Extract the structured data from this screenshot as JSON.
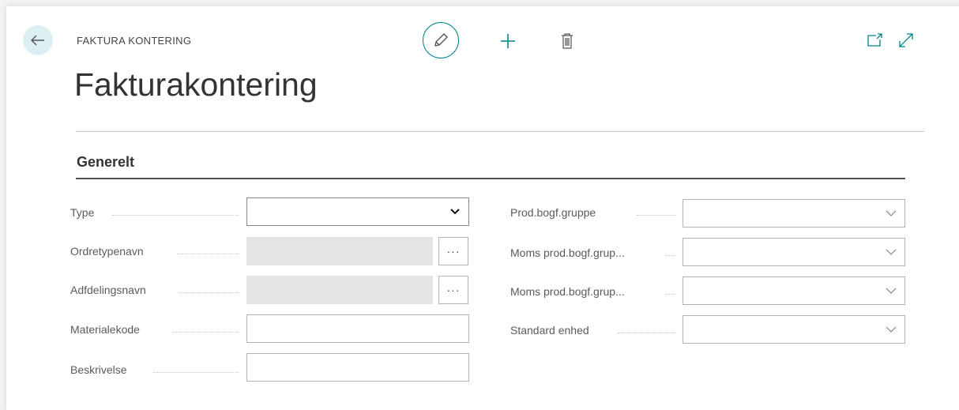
{
  "header": {
    "caption": "FAKTURA KONTERING",
    "title": "Fakturakontering"
  },
  "section": {
    "title": "Generelt"
  },
  "left_fields": [
    {
      "label": "Type",
      "value": ""
    },
    {
      "label": "Ordretypenavn",
      "value": ""
    },
    {
      "label": "Adfdelingsnavn",
      "value": ""
    },
    {
      "label": "Materialekode",
      "value": ""
    },
    {
      "label": "Beskrivelse",
      "value": ""
    }
  ],
  "right_fields": [
    {
      "label": "Prod.bogf.gruppe",
      "value": ""
    },
    {
      "label": "Moms prod.bogf.grup...",
      "value": ""
    },
    {
      "label": "Moms prod.bogf.grup...",
      "value": ""
    },
    {
      "label": "Standard enhed",
      "value": ""
    }
  ],
  "lookup_label": "···",
  "colors": {
    "accent": "#008489",
    "back_bg": "#dceff3",
    "disabled_bg": "#e4e4e4"
  }
}
